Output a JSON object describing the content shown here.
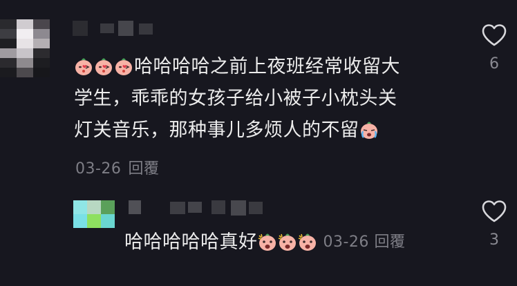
{
  "comments": [
    {
      "text_part1": "哈哈哈哈之前上夜班经常收留大",
      "text_part2": "学生，乖乖的女孩子给小被子小枕头关",
      "text_part3": "灯关音乐，那种事儿多烦人的不留",
      "date": "03-26",
      "reply_label": "回覆",
      "like_count": "6",
      "leading_emoji": [
        "blowing-kiss-emoji",
        "blowing-kiss-emoji",
        "blowing-kiss-emoji"
      ],
      "trailing_emoji": [
        "crying-emoji"
      ]
    },
    {
      "text": "哈哈哈哈哈真好",
      "date": "03-26",
      "reply_label": "回覆",
      "like_count": "3",
      "trailing_emoji": [
        "excited-emoji",
        "excited-emoji",
        "excited-emoji"
      ]
    }
  ],
  "icons": {
    "like": "heart-outline-icon"
  },
  "colors": {
    "background": "#17171f",
    "text": "#ececec",
    "meta": "#7e7e86",
    "emoji_skin": "#f7b2a6",
    "emoji_leaf": "#4aa35a"
  }
}
